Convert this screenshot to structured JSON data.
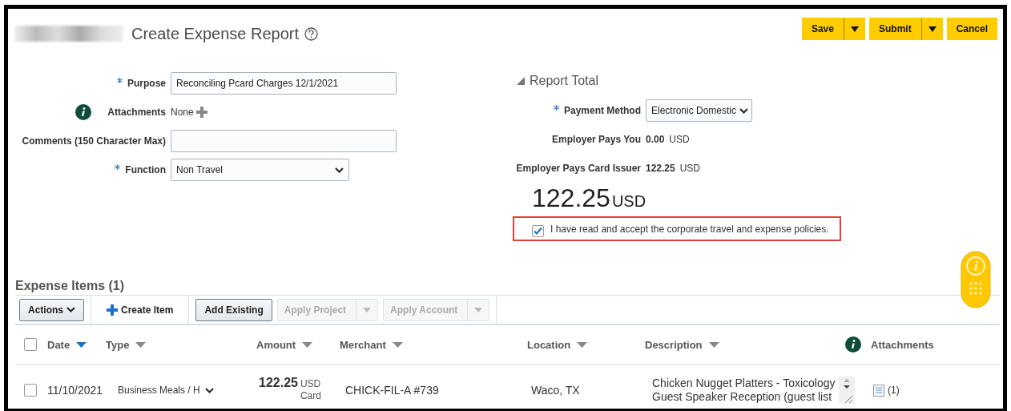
{
  "header": {
    "title": "Create Expense Report",
    "buttons": [
      {
        "label": "Save",
        "kind": "split"
      },
      {
        "label": "Submit",
        "kind": "split"
      },
      {
        "label": "Cancel",
        "kind": "plain"
      }
    ]
  },
  "form": {
    "fields": [
      {
        "label": "Purpose",
        "required": true,
        "kind": "text",
        "value": "Reconciling Pcard Charges 12/1/2021"
      },
      {
        "label": "Attachments",
        "required": false,
        "kind": "attachments",
        "value": "None"
      },
      {
        "label": "Comments (150 Character Max)",
        "required": false,
        "kind": "text"
      },
      {
        "label": "Function",
        "required": true,
        "kind": "select",
        "value": "Non Travel"
      }
    ]
  },
  "report_total": {
    "title": "Report Total",
    "expanded": true,
    "rows": [
      {
        "label": "Payment Method",
        "required": true,
        "kind": "select",
        "value": "Electronic Domestic"
      },
      {
        "label": "Employer Pays You",
        "required": false,
        "kind": "amount",
        "amount": "0.00",
        "currency": "USD"
      },
      {
        "label": "Employer Pays Card Issuer",
        "required": false,
        "kind": "amount",
        "amount": "122.25",
        "currency": "USD"
      }
    ],
    "total": {
      "amount": "122.25",
      "currency": "USD"
    },
    "policy": {
      "label": "I have read and accept the corporate travel and expense policies.",
      "checked": true,
      "highlighted": true
    }
  },
  "expense_items": {
    "title": "Expense Items (1)",
    "toolbar": [
      {
        "label": "Actions",
        "kind": "menu",
        "disabled": false
      },
      {
        "label": "Create Item",
        "kind": "add",
        "disabled": false
      },
      {
        "label": "Add Existing",
        "kind": "button",
        "disabled": false
      },
      {
        "label": "Apply Project",
        "kind": "split",
        "disabled": true
      },
      {
        "label": "Apply Account",
        "kind": "split",
        "disabled": true
      }
    ],
    "all_selected": false,
    "columns": [
      {
        "label": "Date",
        "kind": "sort",
        "sorted": true
      },
      {
        "label": "Type",
        "kind": "sort",
        "sorted": false
      },
      {
        "label": "Amount",
        "kind": "sort",
        "sorted": false
      },
      {
        "label": "Merchant",
        "kind": "sort",
        "sorted": false
      },
      {
        "label": "Location",
        "kind": "sort",
        "sorted": false
      },
      {
        "label": "Description",
        "kind": "sort",
        "sorted": false
      },
      {
        "label": "Attachments",
        "kind": "info"
      }
    ],
    "rows": [
      {
        "selected": false,
        "date": "11/10/2021",
        "type": "Business Meals / H",
        "amount": "122.25",
        "currency": "USD",
        "payment": "Card",
        "merchant": "CHICK-FIL-A #739",
        "location": "Waco, TX",
        "description": [
          "Chicken Nugget Platters - Toxicology",
          "Guest Speaker Reception (guest list"
        ],
        "attachments": "(1)"
      }
    ]
  }
}
